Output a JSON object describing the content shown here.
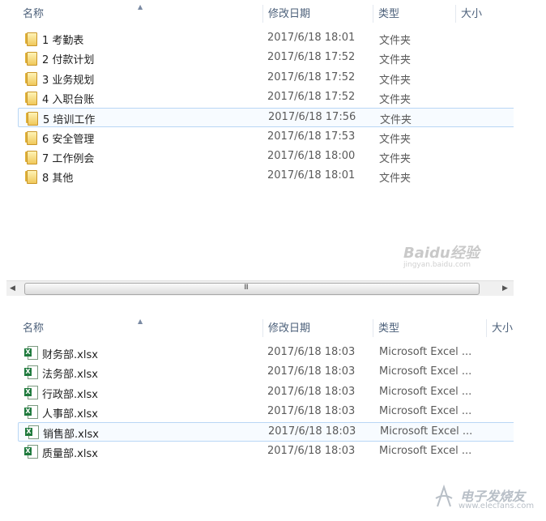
{
  "top_panel": {
    "columns": {
      "name": "名称",
      "date": "修改日期",
      "type": "类型",
      "size": "大小"
    },
    "rows": [
      {
        "name": "1 考勤表",
        "date": "2017/6/18 18:01",
        "type": "文件夹",
        "icon": "folder-icon"
      },
      {
        "name": "2 付款计划",
        "date": "2017/6/18 17:52",
        "type": "文件夹",
        "icon": "folder-icon"
      },
      {
        "name": "3 业务规划",
        "date": "2017/6/18 17:52",
        "type": "文件夹",
        "icon": "folder-icon"
      },
      {
        "name": "4 入职台账",
        "date": "2017/6/18 17:52",
        "type": "文件夹",
        "icon": "folder-icon"
      },
      {
        "name": "5 培训工作",
        "date": "2017/6/18 17:56",
        "type": "文件夹",
        "icon": "folder-icon",
        "selected": true
      },
      {
        "name": "6 安全管理",
        "date": "2017/6/18 17:53",
        "type": "文件夹",
        "icon": "folder-icon"
      },
      {
        "name": "7 工作例会",
        "date": "2017/6/18 18:00",
        "type": "文件夹",
        "icon": "folder-icon"
      },
      {
        "name": "8 其他",
        "date": "2017/6/18 18:01",
        "type": "文件夹",
        "icon": "folder-icon"
      }
    ],
    "scrollbar_grip": "III"
  },
  "bottom_panel": {
    "columns": {
      "name": "名称",
      "date": "修改日期",
      "type": "类型",
      "size": "大小"
    },
    "rows": [
      {
        "name": "财务部.xlsx",
        "date": "2017/6/18 18:03",
        "type": "Microsoft Excel ...",
        "icon": "excel-icon"
      },
      {
        "name": "法务部.xlsx",
        "date": "2017/6/18 18:03",
        "type": "Microsoft Excel ...",
        "icon": "excel-icon"
      },
      {
        "name": "行政部.xlsx",
        "date": "2017/6/18 18:03",
        "type": "Microsoft Excel ...",
        "icon": "excel-icon"
      },
      {
        "name": "人事部.xlsx",
        "date": "2017/6/18 18:03",
        "type": "Microsoft Excel ...",
        "icon": "excel-icon"
      },
      {
        "name": "销售部.xlsx",
        "date": "2017/6/18 18:03",
        "type": "Microsoft Excel ...",
        "icon": "excel-icon",
        "selected": true
      },
      {
        "name": "质量部.xlsx",
        "date": "2017/6/18 18:03",
        "type": "Microsoft Excel ...",
        "icon": "excel-icon"
      }
    ]
  },
  "watermarks": {
    "baidu": "Baidu经验",
    "baidu_url": "jingyan.baidu.com",
    "elecfans": "电子发烧友",
    "elecfans_url": "www.elecfans.com"
  },
  "colors": {
    "accent": "#b9d7f5",
    "header_text": "#4c607a",
    "excel_green": "#1f7a3d",
    "folder_yellow": "#f0c85a"
  }
}
